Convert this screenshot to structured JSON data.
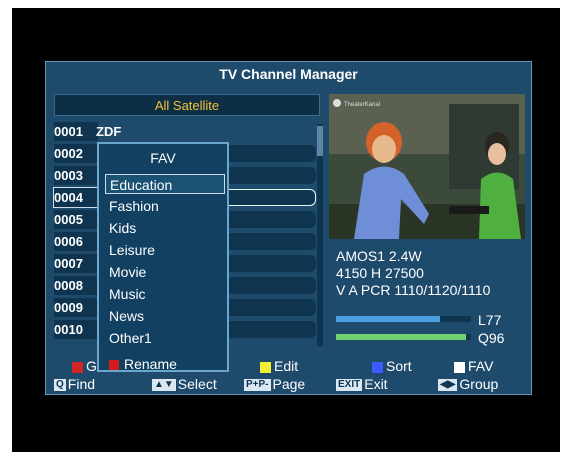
{
  "title": "TV Channel Manager",
  "satellite": "All Satellite",
  "channels": [
    {
      "num": "0001",
      "name": "ZDF"
    },
    {
      "num": "0002",
      "name": ""
    },
    {
      "num": "0003",
      "name": ""
    },
    {
      "num": "0004",
      "name": ""
    },
    {
      "num": "0005",
      "name": ""
    },
    {
      "num": "0006",
      "name": ""
    },
    {
      "num": "0007",
      "name": ""
    },
    {
      "num": "0008",
      "name": ""
    },
    {
      "num": "0009",
      "name": ""
    },
    {
      "num": "0010",
      "name": ""
    }
  ],
  "fav_popup": {
    "heading": "FAV",
    "items": [
      "Education",
      "Fashion",
      "Kids",
      "Leisure",
      "Movie",
      "Music",
      "News",
      "Other1"
    ],
    "rename_label": "Rename"
  },
  "info": {
    "line1": "AMOS1  2.4W",
    "line2": "4150 H 27500",
    "line3": "V A PCR 1110/1120/1110"
  },
  "signal": {
    "level_label": "L77",
    "quality_label": "Q96",
    "level": 0.77,
    "quality": 0.96
  },
  "buttons": {
    "red": "G",
    "yellow": "Edit",
    "blue": "Sort",
    "white": "FAV",
    "find": "Find",
    "select": "Select",
    "page": "Page",
    "exit": "Exit",
    "group": "Group",
    "find_chip": "Q",
    "select_chip": "▲▼",
    "page_chip": "P+P-",
    "exit_chip": "EXIT",
    "group_chip": "◀▶"
  },
  "preview_logo": "TheaterKanal"
}
